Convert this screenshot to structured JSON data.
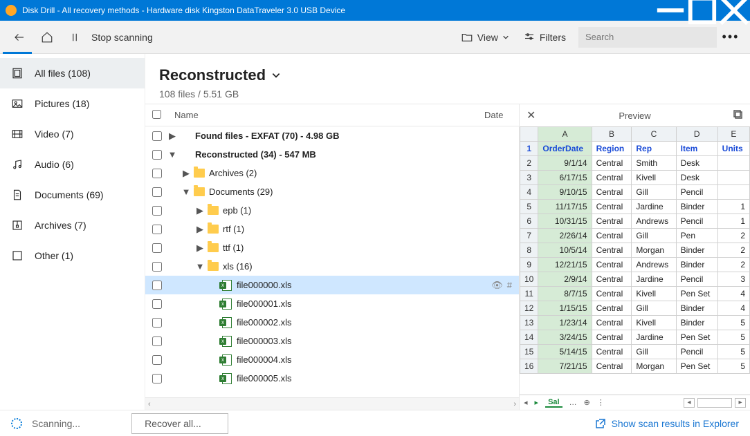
{
  "title": "Disk Drill - All recovery methods - Hardware disk Kingston DataTraveler 3.0 USB Device",
  "toolbar": {
    "stop": "Stop scanning",
    "view": "View",
    "filters": "Filters",
    "search_ph": "Search"
  },
  "sidebar": [
    {
      "icon": "files",
      "label": "All files (108)",
      "active": true
    },
    {
      "icon": "pictures",
      "label": "Pictures (18)"
    },
    {
      "icon": "video",
      "label": "Video (7)"
    },
    {
      "icon": "audio",
      "label": "Audio (6)"
    },
    {
      "icon": "documents",
      "label": "Documents (69)"
    },
    {
      "icon": "archives",
      "label": "Archives (7)"
    },
    {
      "icon": "other",
      "label": "Other (1)"
    }
  ],
  "heading": "Reconstructed",
  "subhead": "108 files / 5.51 GB",
  "columns": {
    "name": "Name",
    "date": "Date"
  },
  "tree": [
    {
      "indent": 0,
      "chk": true,
      "caret": "▶",
      "bold": true,
      "label": "Found files - EXFAT (70) - 4.98 GB"
    },
    {
      "indent": 0,
      "chk": true,
      "caret": "▼",
      "bold": true,
      "label": "Reconstructed (34) - 547 MB"
    },
    {
      "indent": 1,
      "chk": true,
      "caret": "▶",
      "icon": "folder",
      "label": "Archives (2)"
    },
    {
      "indent": 1,
      "chk": true,
      "caret": "▼",
      "icon": "folder",
      "label": "Documents (29)"
    },
    {
      "indent": 2,
      "chk": true,
      "caret": "▶",
      "icon": "folder",
      "label": "epb (1)"
    },
    {
      "indent": 2,
      "chk": true,
      "caret": "▶",
      "icon": "folder",
      "label": "rtf (1)"
    },
    {
      "indent": 2,
      "chk": true,
      "caret": "▶",
      "icon": "folder",
      "label": "ttf (1)"
    },
    {
      "indent": 2,
      "chk": true,
      "caret": "▼",
      "icon": "folder",
      "label": "xls (16)"
    },
    {
      "indent": 3,
      "chk": true,
      "icon": "xls",
      "label": "file000000.xls",
      "selected": true
    },
    {
      "indent": 3,
      "chk": true,
      "icon": "xls",
      "label": "file000001.xls"
    },
    {
      "indent": 3,
      "chk": true,
      "icon": "xls",
      "label": "file000002.xls"
    },
    {
      "indent": 3,
      "chk": true,
      "icon": "xls",
      "label": "file000003.xls"
    },
    {
      "indent": 3,
      "chk": true,
      "icon": "xls",
      "label": "file000004.xls"
    },
    {
      "indent": 3,
      "chk": true,
      "icon": "xls",
      "label": "file000005.xls"
    }
  ],
  "preview": {
    "title": "Preview",
    "cols": [
      "A",
      "B",
      "C",
      "D",
      "E"
    ],
    "headers": [
      "OrderDate",
      "Region",
      "Rep",
      "Item",
      "Units"
    ],
    "rows": [
      [
        "9/1/14",
        "Central",
        "Smith",
        "Desk",
        ""
      ],
      [
        "6/17/15",
        "Central",
        "Kivell",
        "Desk",
        ""
      ],
      [
        "9/10/15",
        "Central",
        "Gill",
        "Pencil",
        ""
      ],
      [
        "11/17/15",
        "Central",
        "Jardine",
        "Binder",
        "1"
      ],
      [
        "10/31/15",
        "Central",
        "Andrews",
        "Pencil",
        "1"
      ],
      [
        "2/26/14",
        "Central",
        "Gill",
        "Pen",
        "2"
      ],
      [
        "10/5/14",
        "Central",
        "Morgan",
        "Binder",
        "2"
      ],
      [
        "12/21/15",
        "Central",
        "Andrews",
        "Binder",
        "2"
      ],
      [
        "2/9/14",
        "Central",
        "Jardine",
        "Pencil",
        "3"
      ],
      [
        "8/7/15",
        "Central",
        "Kivell",
        "Pen Set",
        "4"
      ],
      [
        "1/15/15",
        "Central",
        "Gill",
        "Binder",
        "4"
      ],
      [
        "1/23/14",
        "Central",
        "Kivell",
        "Binder",
        "5"
      ],
      [
        "3/24/15",
        "Central",
        "Jardine",
        "Pen Set",
        "5"
      ],
      [
        "5/14/15",
        "Central",
        "Gill",
        "Pencil",
        "5"
      ],
      [
        "7/21/15",
        "Central",
        "Morgan",
        "Pen Set",
        "5"
      ]
    ],
    "tab": "Sal"
  },
  "status": {
    "scanning": "Scanning...",
    "recover": "Recover all...",
    "show": "Show scan results in Explorer"
  }
}
